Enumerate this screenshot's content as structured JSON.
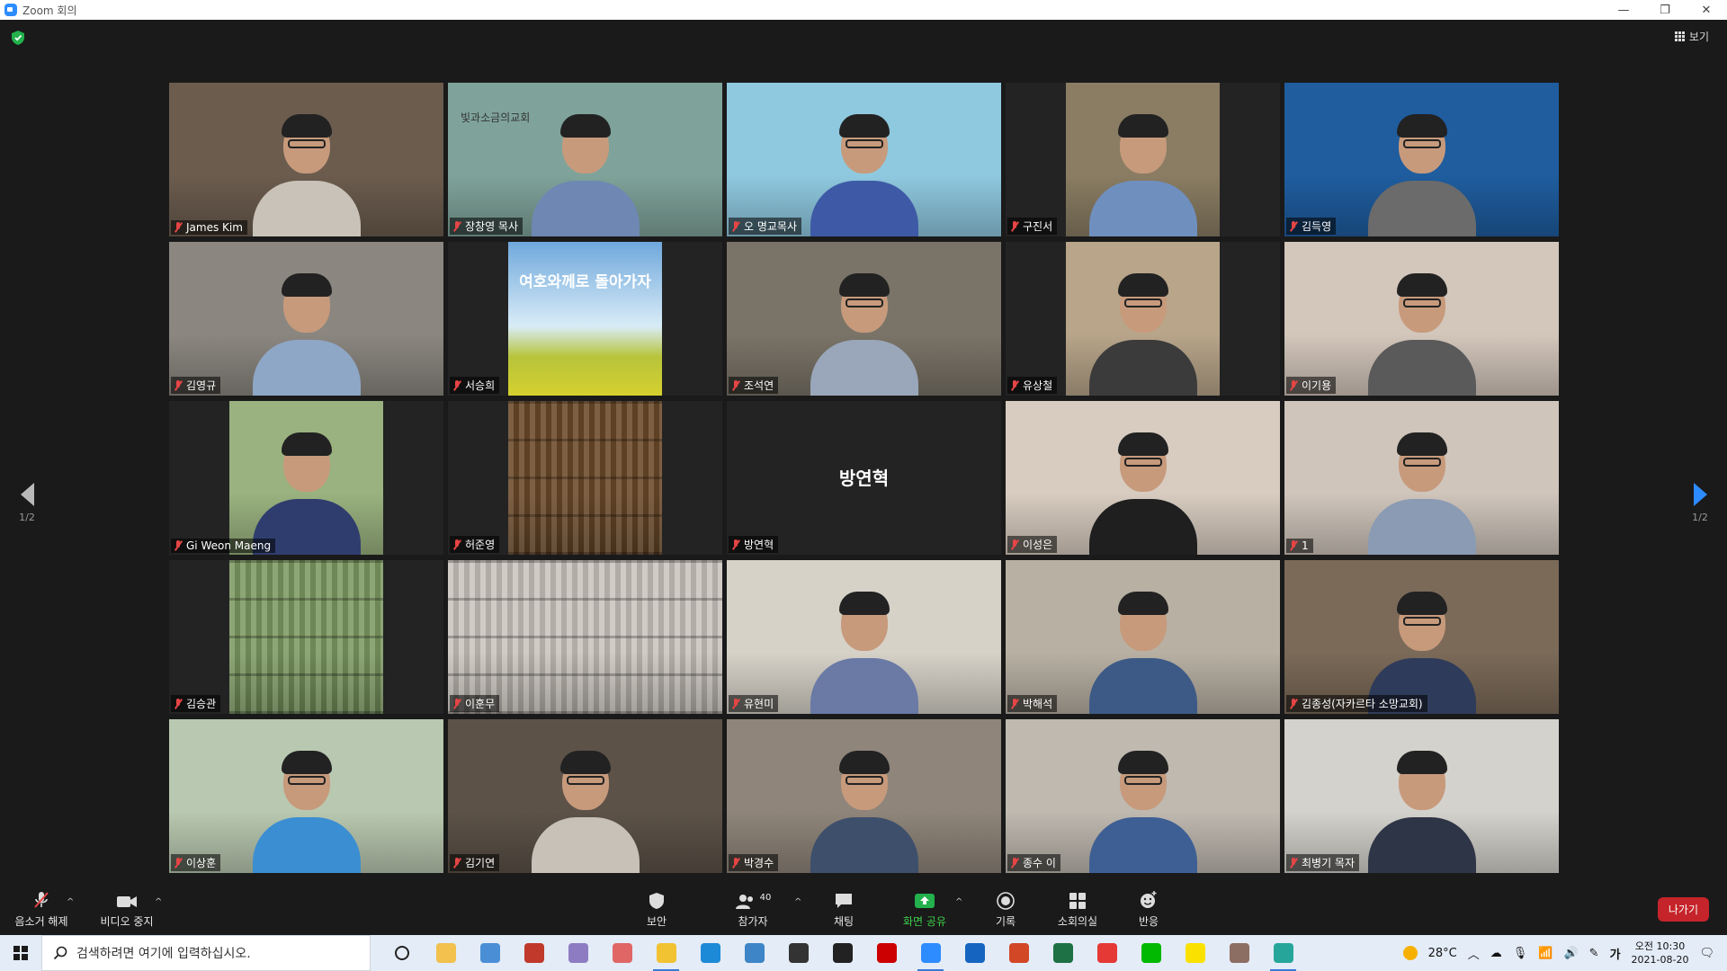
{
  "window": {
    "title": "Zoom 회의",
    "controls": [
      "—",
      "❐",
      "✕"
    ]
  },
  "view_button": "보기",
  "pages": {
    "left": "1/2",
    "right": "1/2"
  },
  "participants": [
    {
      "name": "James Kim",
      "bg": "#6b5c4e",
      "shirt": "#c9c2b8",
      "glasses": true
    },
    {
      "name": "장창영 목사",
      "bg": "#7fa39a",
      "shirt": "#6e87b3",
      "glasses": false,
      "overlay": "빛과소금의교회"
    },
    {
      "name": "오 명교목사",
      "bg": "#8fc9e0",
      "shirt": "#3e5aa6",
      "glasses": true,
      "active": true
    },
    {
      "name": "구진서",
      "bg": "#8a7d63",
      "shirt": "#6f8fbf",
      "glasses": false
    },
    {
      "name": "김득영",
      "bg": "#1f5d9f",
      "shirt": "#6b6b6b",
      "glasses": true
    },
    {
      "name": "김영규",
      "bg": "#8b8780",
      "shirt": "#8fa7c6",
      "glasses": false
    },
    {
      "name": "서승희",
      "bg": "#6fa8dc",
      "shirt": "#c9c24a",
      "glasses": false,
      "overlay": "여호와께로 돌아가자",
      "poster": true
    },
    {
      "name": "조석연",
      "bg": "#7a7468",
      "shirt": "#9aa6b9",
      "glasses": true
    },
    {
      "name": "유상철",
      "bg": "#b8a58a",
      "shirt": "#3b3b3b",
      "glasses": true
    },
    {
      "name": "이기용",
      "bg": "#d3c6bb",
      "shirt": "#5a5a5a",
      "glasses": true
    },
    {
      "name": "Gi Weon Maeng",
      "bg": "#9ab27f",
      "shirt": "#2f3d6e",
      "glasses": false
    },
    {
      "name": "허준영",
      "bg": "#6b4a2a",
      "shirt": "#3e6b4c",
      "glasses": false,
      "noperson": true
    },
    {
      "name": "방연혁",
      "bg": "#232323",
      "shirt": "#232323",
      "glasses": false,
      "nameonly": true
    },
    {
      "name": "이성은",
      "bg": "#d8ccc0",
      "shirt": "#1f1f1f",
      "glasses": true
    },
    {
      "name": "1",
      "bg": "#cfc5bb",
      "shirt": "#8a9bb3",
      "glasses": true
    },
    {
      "name": "김승관",
      "bg": "#7d9a62",
      "shirt": "#8d8d8d",
      "glasses": false,
      "noperson": true
    },
    {
      "name": "이훈무",
      "bg": "#c9c4bc",
      "shirt": "#c9c4bc",
      "glasses": false,
      "noperson": true
    },
    {
      "name": "유현미",
      "bg": "#d6d2c8",
      "shirt": "#6a7aa5",
      "glasses": false
    },
    {
      "name": "박해석",
      "bg": "#b8b0a3",
      "shirt": "#3d5a86",
      "glasses": false
    },
    {
      "name": "김종성(자카르타 소망교회)",
      "bg": "#7b6a58",
      "shirt": "#2f3b5a",
      "glasses": true
    },
    {
      "name": "이상훈",
      "bg": "#b9c8b0",
      "shirt": "#3b8ed2",
      "glasses": true
    },
    {
      "name": "김기연",
      "bg": "#5c5248",
      "shirt": "#c7c1b8",
      "glasses": true
    },
    {
      "name": "박경수",
      "bg": "#8f857a",
      "shirt": "#3d4f6b",
      "glasses": true
    },
    {
      "name": "종수 이",
      "bg": "#bfb9b0",
      "shirt": "#3e5f94",
      "glasses": true
    },
    {
      "name": "최병기 목자",
      "bg": "#d4d2cc",
      "shirt": "#2e3546",
      "glasses": false
    }
  ],
  "toolbar": {
    "unmute": "음소거 해제",
    "stop_video": "비디오 중지",
    "security": "보안",
    "participants": "참가자",
    "participants_count": "40",
    "chat": "채팅",
    "share_screen": "화면 공유",
    "record": "기록",
    "breakout": "소회의실",
    "reactions": "반응",
    "leave": "나가기"
  },
  "taskbar": {
    "search_placeholder": "검색하려면 여기에 입력하십시오.",
    "weather": "28°C",
    "ime": "가",
    "time": "오전 10:30",
    "date": "2021-08-20",
    "apps": [
      {
        "name": "task-view-icon",
        "color": "#e4ecf7"
      },
      {
        "name": "file-explorer-icon",
        "color": "#f2c14e"
      },
      {
        "name": "app-blue-icon",
        "color": "#4a8fd6"
      },
      {
        "name": "app-red-doc-icon",
        "color": "#c0392b"
      },
      {
        "name": "app-paint-icon",
        "color": "#8e7cc3"
      },
      {
        "name": "app-snip-icon",
        "color": "#e06666"
      },
      {
        "name": "chrome-icon",
        "color": "#f1c232"
      },
      {
        "name": "edge-icon",
        "color": "#1c8ad6"
      },
      {
        "name": "ie-icon",
        "color": "#3d85c6"
      },
      {
        "name": "app-media-icon",
        "color": "#333333"
      },
      {
        "name": "app-black-icon",
        "color": "#222222"
      },
      {
        "name": "app-red-icon",
        "color": "#cc0000"
      },
      {
        "name": "zoom-icon",
        "color": "#2d8cff"
      },
      {
        "name": "app-docs-icon",
        "color": "#1565c0"
      },
      {
        "name": "powerpoint-icon",
        "color": "#d24726"
      },
      {
        "name": "excel-icon",
        "color": "#1e7145"
      },
      {
        "name": "app-hancom-icon",
        "color": "#e53935"
      },
      {
        "name": "line-icon",
        "color": "#00b900"
      },
      {
        "name": "kakaotalk-icon",
        "color": "#fae100"
      },
      {
        "name": "app-photo-icon",
        "color": "#8d6e63"
      },
      {
        "name": "app-browser-icon",
        "color": "#26a69a"
      }
    ]
  }
}
